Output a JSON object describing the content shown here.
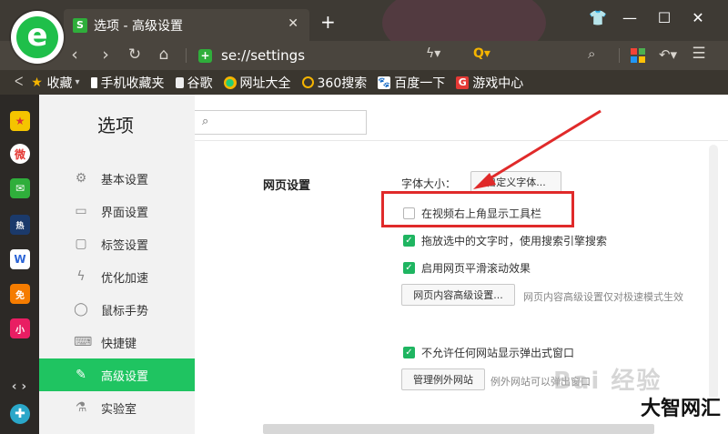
{
  "browser": {
    "tab_title": "选项 - 高级设置",
    "tab_icon_glyph": "S",
    "new_tab": "+",
    "address": "se://settings",
    "logo_letter": "e",
    "colors": {
      "accent": "#1fc461",
      "brand_green": "#1fbf4a",
      "highlight_red": "#e02a2a"
    }
  },
  "bookmarks": [
    {
      "label": "收藏",
      "icon": "star-icon"
    },
    {
      "label": "手机收藏夹",
      "icon": "phone-icon"
    },
    {
      "label": "谷歌",
      "icon": "page-icon"
    },
    {
      "label": "网址大全",
      "icon": "globe-icon"
    },
    {
      "label": "360搜索",
      "icon": "search-360-icon"
    },
    {
      "label": "百度一下",
      "icon": "baidu-icon"
    },
    {
      "label": "游戏中心",
      "icon": "game-icon"
    }
  ],
  "app_strip": {
    "items": [
      {
        "name": "favorites-app-icon",
        "glyph": "★"
      },
      {
        "name": "weibo-app-icon",
        "glyph": "微"
      },
      {
        "name": "mail-app-icon",
        "glyph": "✉"
      },
      {
        "name": "news-app-icon",
        "glyph": "热"
      },
      {
        "name": "doc-app-icon",
        "glyph": "W"
      },
      {
        "name": "novel-app-icon",
        "glyph": "免"
      },
      {
        "name": "game-app-icon",
        "glyph": "小"
      }
    ]
  },
  "settings": {
    "page_title": "选项",
    "search_placeholder": "",
    "nav": [
      {
        "label": "基本设置",
        "icon": "gear-icon",
        "glyph": "⚙"
      },
      {
        "label": "界面设置",
        "icon": "window-icon",
        "glyph": "▭"
      },
      {
        "label": "标签设置",
        "icon": "tab-icon",
        "glyph": "▢"
      },
      {
        "label": "优化加速",
        "icon": "bolt-icon",
        "glyph": "ϟ"
      },
      {
        "label": "鼠标手势",
        "icon": "mouse-icon",
        "glyph": "◯"
      },
      {
        "label": "快捷键",
        "icon": "keyboard-icon",
        "glyph": "⌨"
      },
      {
        "label": "高级设置",
        "icon": "wrench-icon",
        "glyph": "✎",
        "active": true
      },
      {
        "label": "实验室",
        "icon": "flask-icon",
        "glyph": "⚗"
      }
    ],
    "section_label": "网页设置",
    "font_size_label": "字体大小：",
    "custom_font_button": "自定义字体...",
    "options": [
      {
        "label": "在视频右上角显示工具栏",
        "checked": false
      },
      {
        "label": "拖放选中的文字时，使用搜索引擎搜索",
        "checked": true
      },
      {
        "label": "启用网页平滑滚动效果",
        "checked": true
      }
    ],
    "advanced_content_button": "网页内容高级设置...",
    "advanced_content_desc": "网页内容高级设置仅对极速模式生效",
    "popup_option": {
      "label": "不允许任何网站显示弹出式窗口",
      "checked": true
    },
    "manage_exceptions_button": "管理例外网站",
    "manage_exceptions_desc": "例外网站可以弹出窗口"
  },
  "watermark": {
    "text": "大智网汇",
    "faint": "Bai 经验"
  }
}
